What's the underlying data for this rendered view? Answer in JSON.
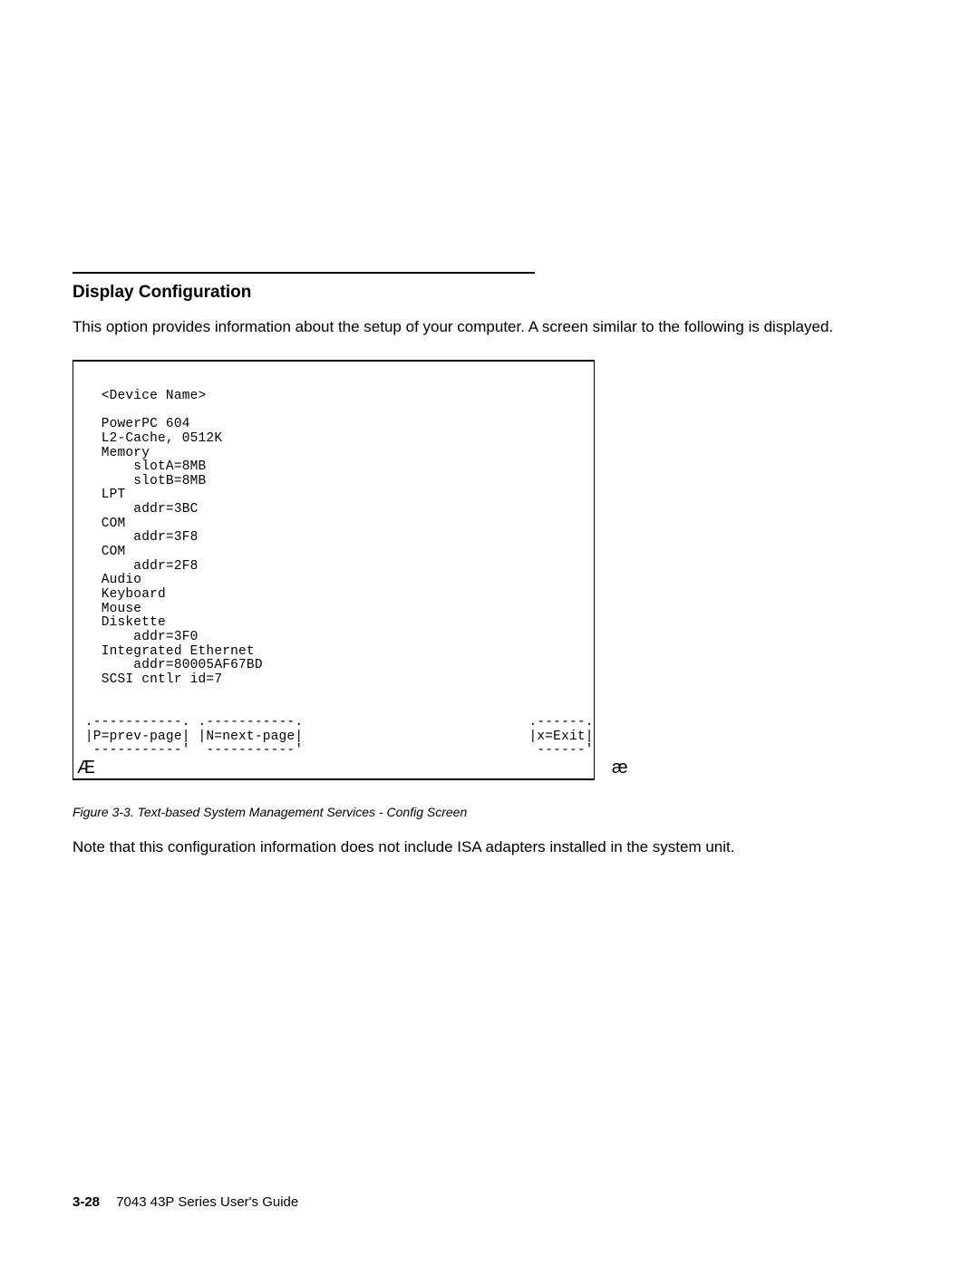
{
  "heading": "Display Configuration",
  "intro": "This option provides information about the setup of your computer. A screen similar to the following is displayed.",
  "screen": {
    "lines": [
      "",
      "   <Device Name>",
      "",
      "   PowerPC 604",
      "   L2-Cache, 0512K",
      "   Memory",
      "       slotA=8MB",
      "       slotB=8MB",
      "   LPT",
      "       addr=3BC",
      "   COM",
      "       addr=3F8",
      "   COM",
      "       addr=2F8",
      "   Audio",
      "   Keyboard",
      "   Mouse",
      "   Diskette",
      "       addr=3F0",
      "   Integrated Ethernet",
      "       addr=80005AF67BD",
      "   SCSI cntlr id=7",
      "",
      ""
    ],
    "nav": {
      "sep_top": " .-----------. .-----------.                            .------.",
      "row": " |P=prev-page| |N=next-page|                            |x=Exit|",
      "sep_bot": "  -----------'  -----------'                             ------'"
    },
    "corner_left": "Æ",
    "corner_right": "æ"
  },
  "caption": "Figure   3-3. Text-based System Management Services - Config Screen",
  "note": "Note that this configuration information does not include ISA adapters installed in the system unit.",
  "footer": {
    "page_num": "3-28",
    "book": "7043 43P Series User's Guide"
  }
}
